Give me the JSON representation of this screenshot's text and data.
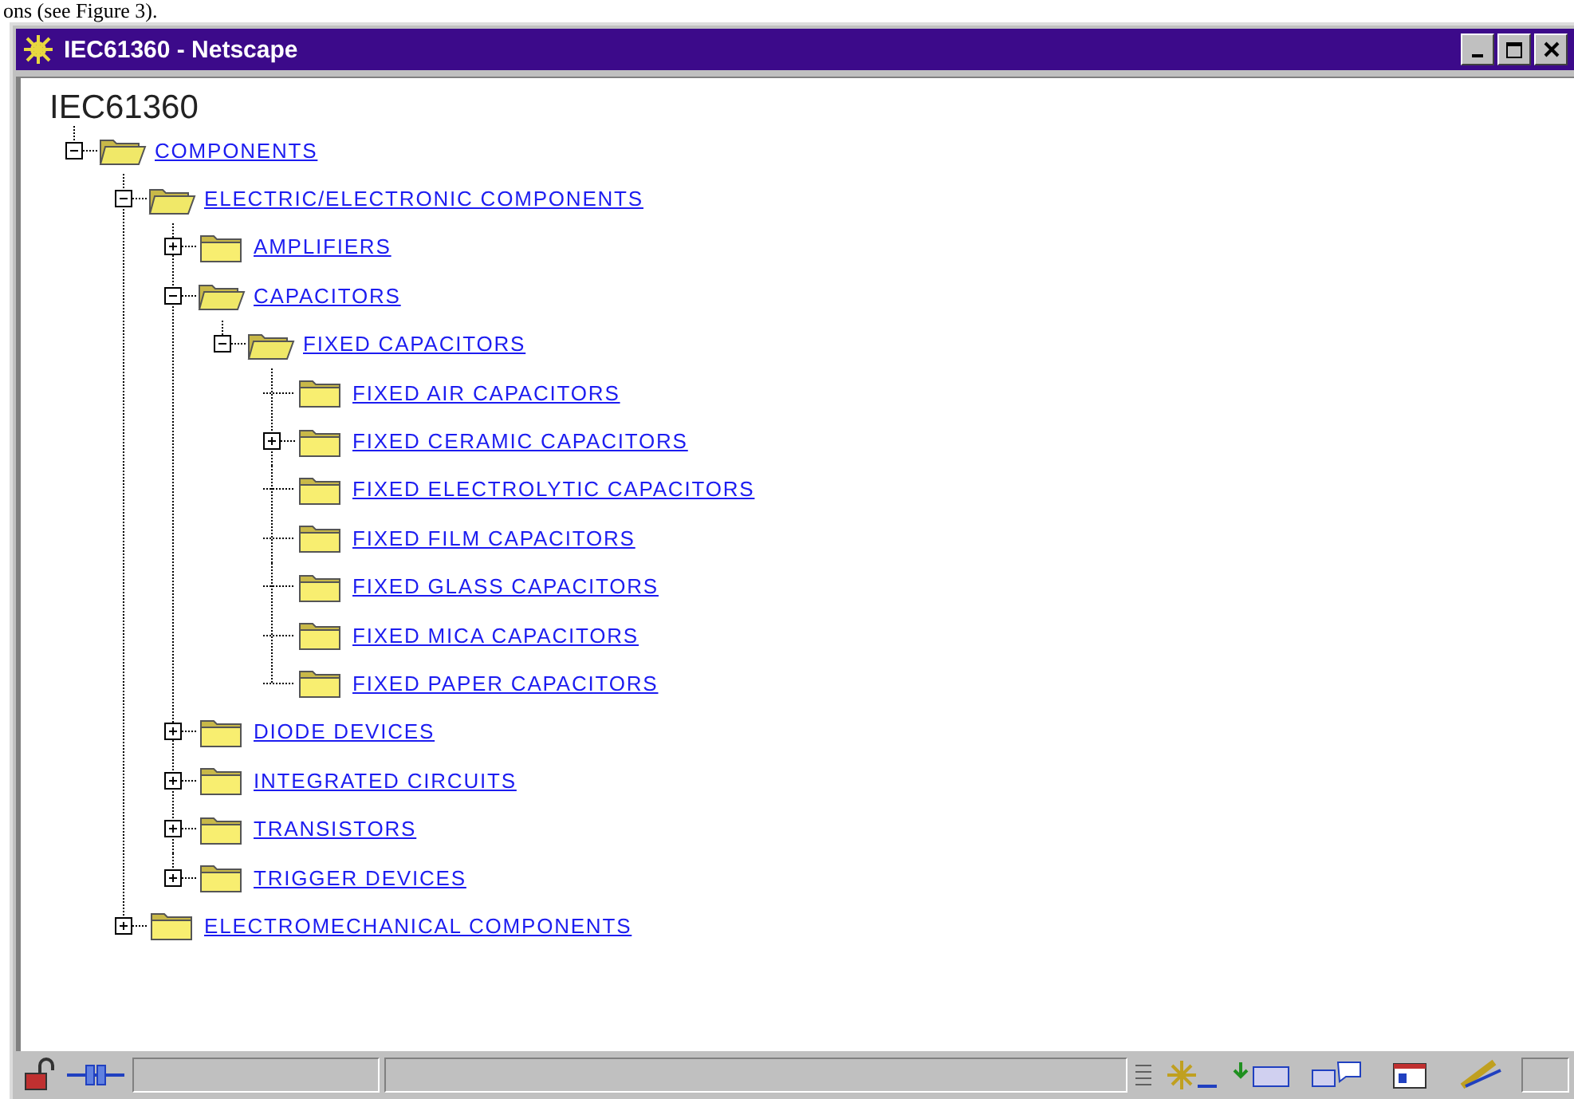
{
  "caption": "ons (see Figure 3).",
  "window": {
    "title": "IEC61360 - Netscape"
  },
  "tree": {
    "title": "IEC61360",
    "items": [
      {
        "label": "COMPONENTS",
        "expanded": true,
        "children": [
          {
            "label": "ELECTRIC/ELECTRONIC COMPONENTS",
            "expanded": true,
            "children": [
              {
                "label": "AMPLIFIERS",
                "expanded": false
              },
              {
                "label": "CAPACITORS",
                "expanded": true,
                "children": [
                  {
                    "label": "FIXED CAPACITORS",
                    "expanded": true,
                    "children": [
                      {
                        "label": "FIXED AIR CAPACITORS"
                      },
                      {
                        "label": "FIXED CERAMIC CAPACITORS",
                        "expanded": false
                      },
                      {
                        "label": "FIXED ELECTROLYTIC CAPACITORS"
                      },
                      {
                        "label": "FIXED FILM CAPACITORS"
                      },
                      {
                        "label": "FIXED GLASS CAPACITORS"
                      },
                      {
                        "label": "FIXED MICA CAPACITORS"
                      },
                      {
                        "label": "FIXED PAPER CAPACITORS"
                      }
                    ]
                  }
                ]
              },
              {
                "label": "DIODE DEVICES",
                "expanded": false
              },
              {
                "label": "INTEGRATED CIRCUITS",
                "expanded": false
              },
              {
                "label": "TRANSISTORS",
                "expanded": false
              },
              {
                "label": "TRIGGER DEVICES",
                "expanded": false
              }
            ]
          },
          {
            "label": "ELECTROMECHANICAL COMPONENTS",
            "expanded": false
          }
        ]
      }
    ]
  }
}
